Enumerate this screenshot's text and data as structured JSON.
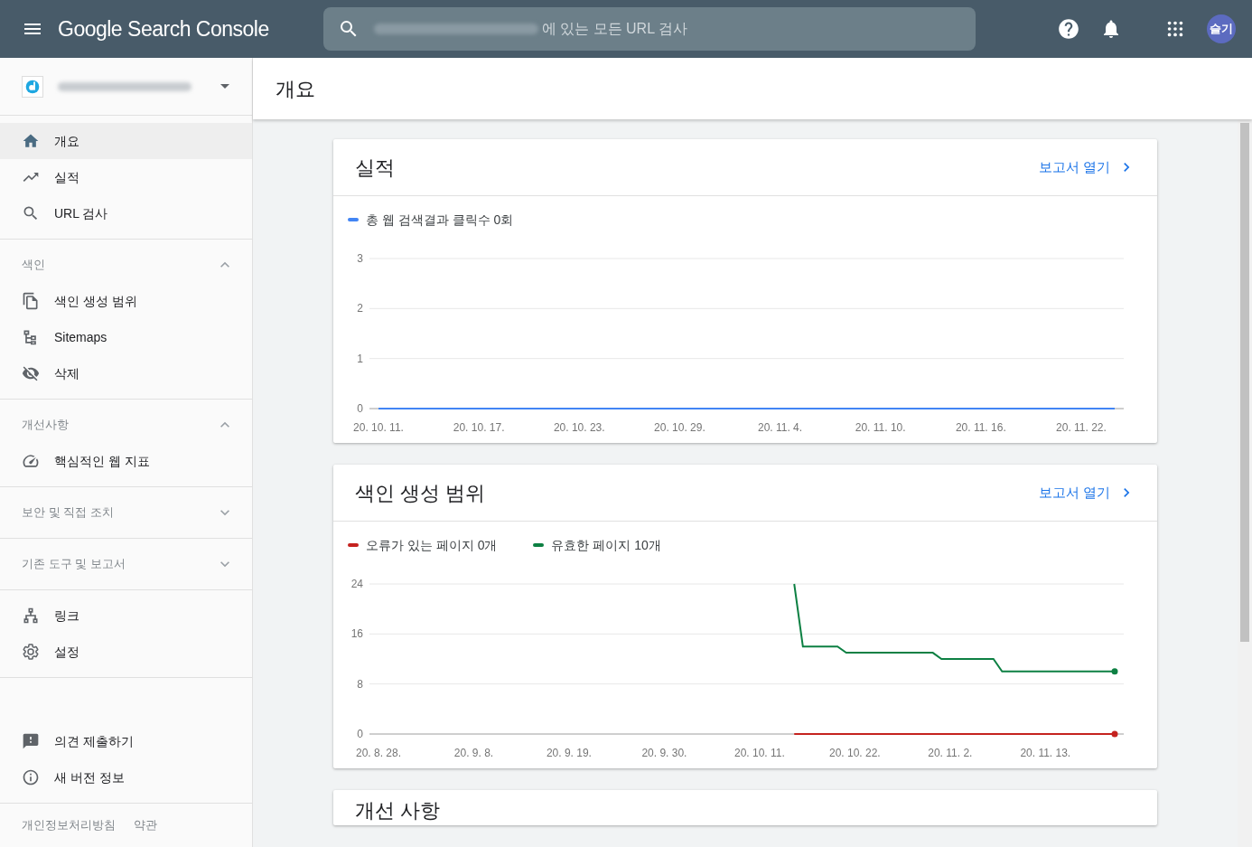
{
  "header": {
    "product": "Google Search Console",
    "search": {
      "placeholder": "에 있는 모든 URL 검사"
    },
    "avatar": "슬기"
  },
  "sidebar": {
    "groups": [
      {
        "items": [
          {
            "label": "개요",
            "selected": true
          },
          {
            "label": "실적",
            "selected": false
          },
          {
            "label": "URL 검사",
            "selected": false
          }
        ]
      },
      {
        "header": {
          "label": "색인",
          "expanded": true
        },
        "items": [
          {
            "label": "색인 생성 범위",
            "selected": false
          },
          {
            "label": "Sitemaps",
            "selected": false
          },
          {
            "label": "삭제",
            "selected": false
          }
        ]
      },
      {
        "header": {
          "label": "개선사항",
          "expanded": true
        },
        "items": [
          {
            "label": "핵심적인 웹 지표",
            "selected": false
          }
        ]
      },
      {
        "header": {
          "label": "보안 및 직접 조치",
          "expanded": false
        }
      },
      {
        "header": {
          "label": "기존 도구 및 보고서",
          "expanded": false
        }
      },
      {
        "items": [
          {
            "label": "링크",
            "selected": false
          },
          {
            "label": "설정",
            "selected": false
          }
        ]
      }
    ],
    "bottom_items": [
      {
        "label": "의견 제출하기"
      },
      {
        "label": "새 버전 정보"
      }
    ],
    "footer_links": [
      "개인정보처리방침",
      "약관"
    ]
  },
  "page_title": "개요",
  "cards": [
    {
      "title": "실적",
      "link": "보고서 열기",
      "chart_data": {
        "type": "line",
        "ylim": [
          0,
          3
        ],
        "yticks": [
          0,
          1,
          2,
          3
        ],
        "categories": [
          "20. 10. 11.",
          null,
          null,
          null,
          null,
          null,
          "20. 10. 17.",
          null,
          null,
          null,
          null,
          null,
          "20. 10. 23.",
          null,
          null,
          null,
          null,
          null,
          "20. 10. 29.",
          null,
          null,
          null,
          null,
          null,
          "20. 11. 4.",
          null,
          null,
          null,
          null,
          null,
          "20. 11. 10.",
          null,
          null,
          null,
          null,
          null,
          "20. 11. 16.",
          null,
          null,
          null,
          null,
          null,
          "20. 11. 22.",
          null,
          null
        ],
        "series": [
          {
            "name": "총 웹 검색결과 클릭수 0회",
            "color": "#4285f4",
            "values": [
              0,
              0,
              0,
              0,
              0,
              0,
              0,
              0,
              0,
              0,
              0,
              0,
              0,
              0,
              0,
              0,
              0,
              0,
              0,
              0,
              0,
              0,
              0,
              0,
              0,
              0,
              0,
              0,
              0,
              0,
              0,
              0,
              0,
              0,
              0,
              0,
              0,
              0,
              0,
              0,
              0,
              0,
              0,
              0,
              0
            ]
          }
        ]
      }
    },
    {
      "title": "색인 생성 범위",
      "link": "보고서 열기",
      "chart_data": {
        "type": "line",
        "ylim": [
          0,
          24
        ],
        "yticks": [
          0,
          8,
          16,
          24
        ],
        "categories": [
          "20. 8. 28.",
          null,
          null,
          null,
          null,
          null,
          null,
          null,
          null,
          null,
          null,
          "20. 9. 8.",
          null,
          null,
          null,
          null,
          null,
          null,
          null,
          null,
          null,
          null,
          "20. 9. 19.",
          null,
          null,
          null,
          null,
          null,
          null,
          null,
          null,
          null,
          null,
          "20. 9. 30.",
          null,
          null,
          null,
          null,
          null,
          null,
          null,
          null,
          null,
          null,
          "20. 10. 11.",
          null,
          null,
          null,
          null,
          null,
          null,
          null,
          null,
          null,
          null,
          "20. 10. 22.",
          null,
          null,
          null,
          null,
          null,
          null,
          null,
          null,
          null,
          null,
          "20. 11. 2.",
          null,
          null,
          null,
          null,
          null,
          null,
          null,
          null,
          null,
          null,
          "20. 11. 13.",
          null,
          null,
          null,
          null,
          null,
          null,
          null,
          null
        ],
        "series": [
          {
            "name": "오류가 있는 페이지 0개",
            "color": "#c5221f",
            "values": [
              null,
              null,
              null,
              null,
              null,
              null,
              null,
              null,
              null,
              null,
              null,
              null,
              null,
              null,
              null,
              null,
              null,
              null,
              null,
              null,
              null,
              null,
              null,
              null,
              null,
              null,
              null,
              null,
              null,
              null,
              null,
              null,
              null,
              null,
              null,
              null,
              null,
              null,
              null,
              null,
              null,
              null,
              null,
              null,
              null,
              null,
              null,
              null,
              0,
              0,
              0,
              0,
              0,
              0,
              0,
              0,
              0,
              0,
              0,
              0,
              0,
              0,
              0,
              0,
              0,
              0,
              0,
              0,
              0,
              0,
              0,
              0,
              0,
              0,
              0,
              0,
              0,
              0,
              0,
              0,
              0,
              0,
              0,
              0,
              0,
              0
            ]
          },
          {
            "name": "유효한 페이지 10개",
            "color": "#0d8043",
            "values": [
              null,
              null,
              null,
              null,
              null,
              null,
              null,
              null,
              null,
              null,
              null,
              null,
              null,
              null,
              null,
              null,
              null,
              null,
              null,
              null,
              null,
              null,
              null,
              null,
              null,
              null,
              null,
              null,
              null,
              null,
              null,
              null,
              null,
              null,
              null,
              null,
              null,
              null,
              null,
              null,
              null,
              null,
              null,
              null,
              null,
              null,
              null,
              null,
              24,
              14,
              14,
              14,
              14,
              14,
              13,
              13,
              13,
              13,
              13,
              13,
              13,
              13,
              13,
              13,
              13,
              12,
              12,
              12,
              12,
              12,
              12,
              12,
              10,
              10,
              10,
              10,
              10,
              10,
              10,
              10,
              10,
              10,
              10,
              10,
              10,
              10
            ]
          }
        ]
      }
    },
    {
      "title": "개선 사항"
    }
  ]
}
